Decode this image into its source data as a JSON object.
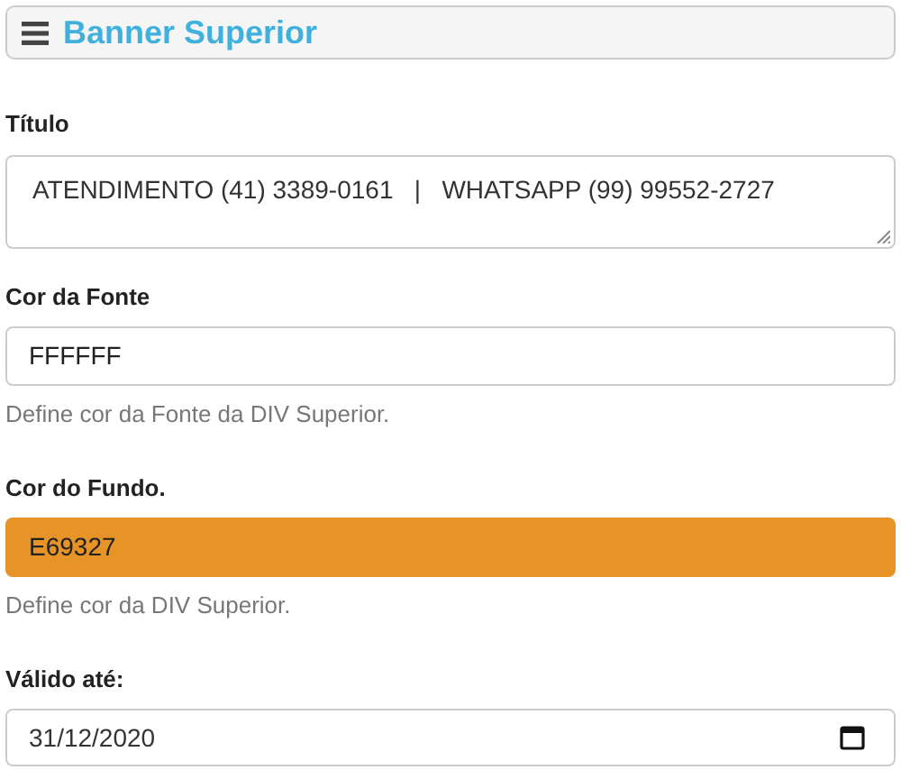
{
  "header": {
    "title": "Banner Superior"
  },
  "fields": [
    {
      "label": "Título",
      "kind": "textarea",
      "value": "ATENDIMENTO (41) 3389-0161   |   WHATSAPP (99) 99552-2727"
    },
    {
      "label": "Cor da Fonte",
      "kind": "text",
      "value": "FFFFFF",
      "help": "Define cor da Fonte da DIV Superior."
    },
    {
      "label": "Cor do Fundo.",
      "kind": "text",
      "value": "E69327",
      "color": "#e69327",
      "help": "Define cor da DIV Superior."
    },
    {
      "label": "Válido até:",
      "kind": "date",
      "value": "31/12/2020"
    }
  ]
}
